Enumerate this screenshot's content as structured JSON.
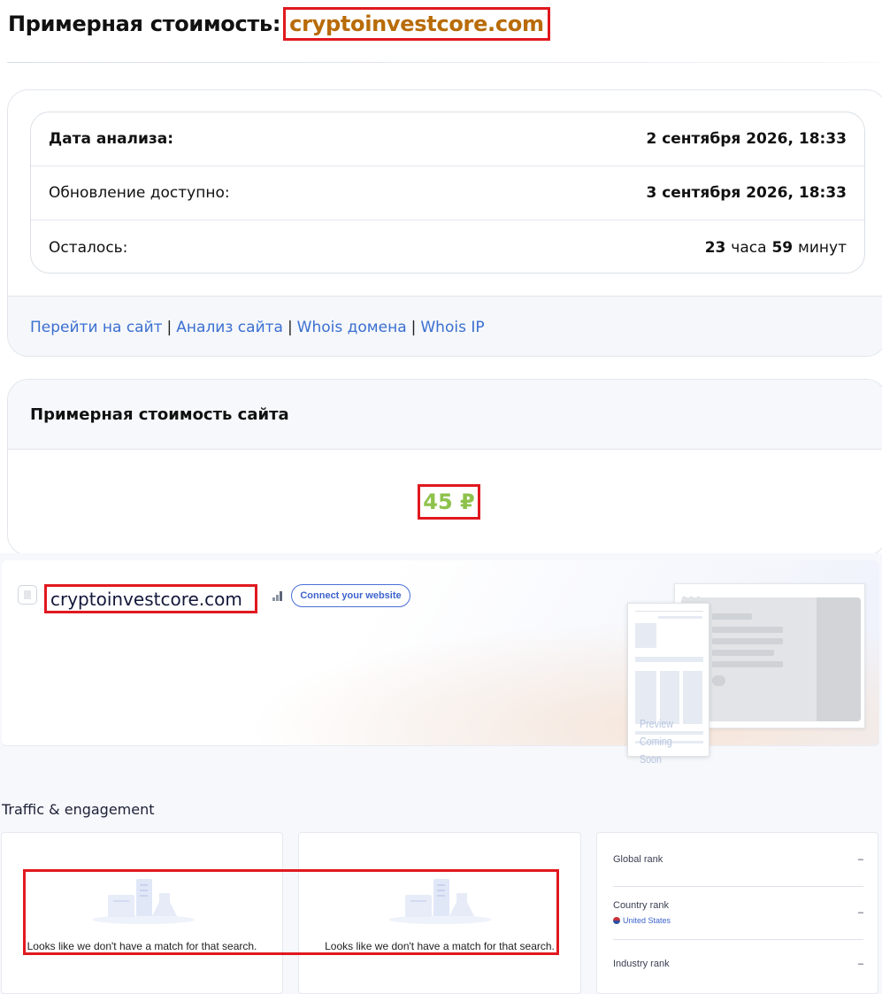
{
  "header": {
    "title_prefix": "Примерная стоимость:",
    "domain": "cryptoinvestcore.com"
  },
  "analysis": {
    "rows": [
      {
        "label": "Дата анализа:",
        "value": "2 сентября 2026, 18:33"
      },
      {
        "label": "Обновление доступно:",
        "value": "3 сентября 2026, 18:33"
      },
      {
        "label": "Осталось:",
        "hours_num": "23",
        "hours_word": "часа",
        "minutes_num": "59",
        "minutes_word": "минут"
      }
    ]
  },
  "links": [
    {
      "label": "Перейти на сайт"
    },
    {
      "label": "Анализ сайта"
    },
    {
      "label": "Whois домена"
    },
    {
      "label": "Whois IP"
    }
  ],
  "link_separator": "|",
  "value_card": {
    "title": "Примерная стоимость сайта",
    "price": "45 ₽",
    "price_color": "#8dc24b"
  },
  "similarweb": {
    "domain": "cryptoinvestcore.com",
    "connect_button": "Connect your website",
    "preview_text_1": "Preview",
    "preview_text_2": "Coming Soon",
    "section_title": "Traffic & engagement",
    "empty_message": "Looks like we don't have a match for that search.",
    "ranks": [
      {
        "label": "Global rank",
        "value": "–"
      },
      {
        "label": "Country rank",
        "value": "–",
        "country": "United States"
      },
      {
        "label": "Industry rank",
        "value": "–"
      }
    ],
    "accent_color": "#3d63cc"
  },
  "highlight_color": "#e0191f"
}
